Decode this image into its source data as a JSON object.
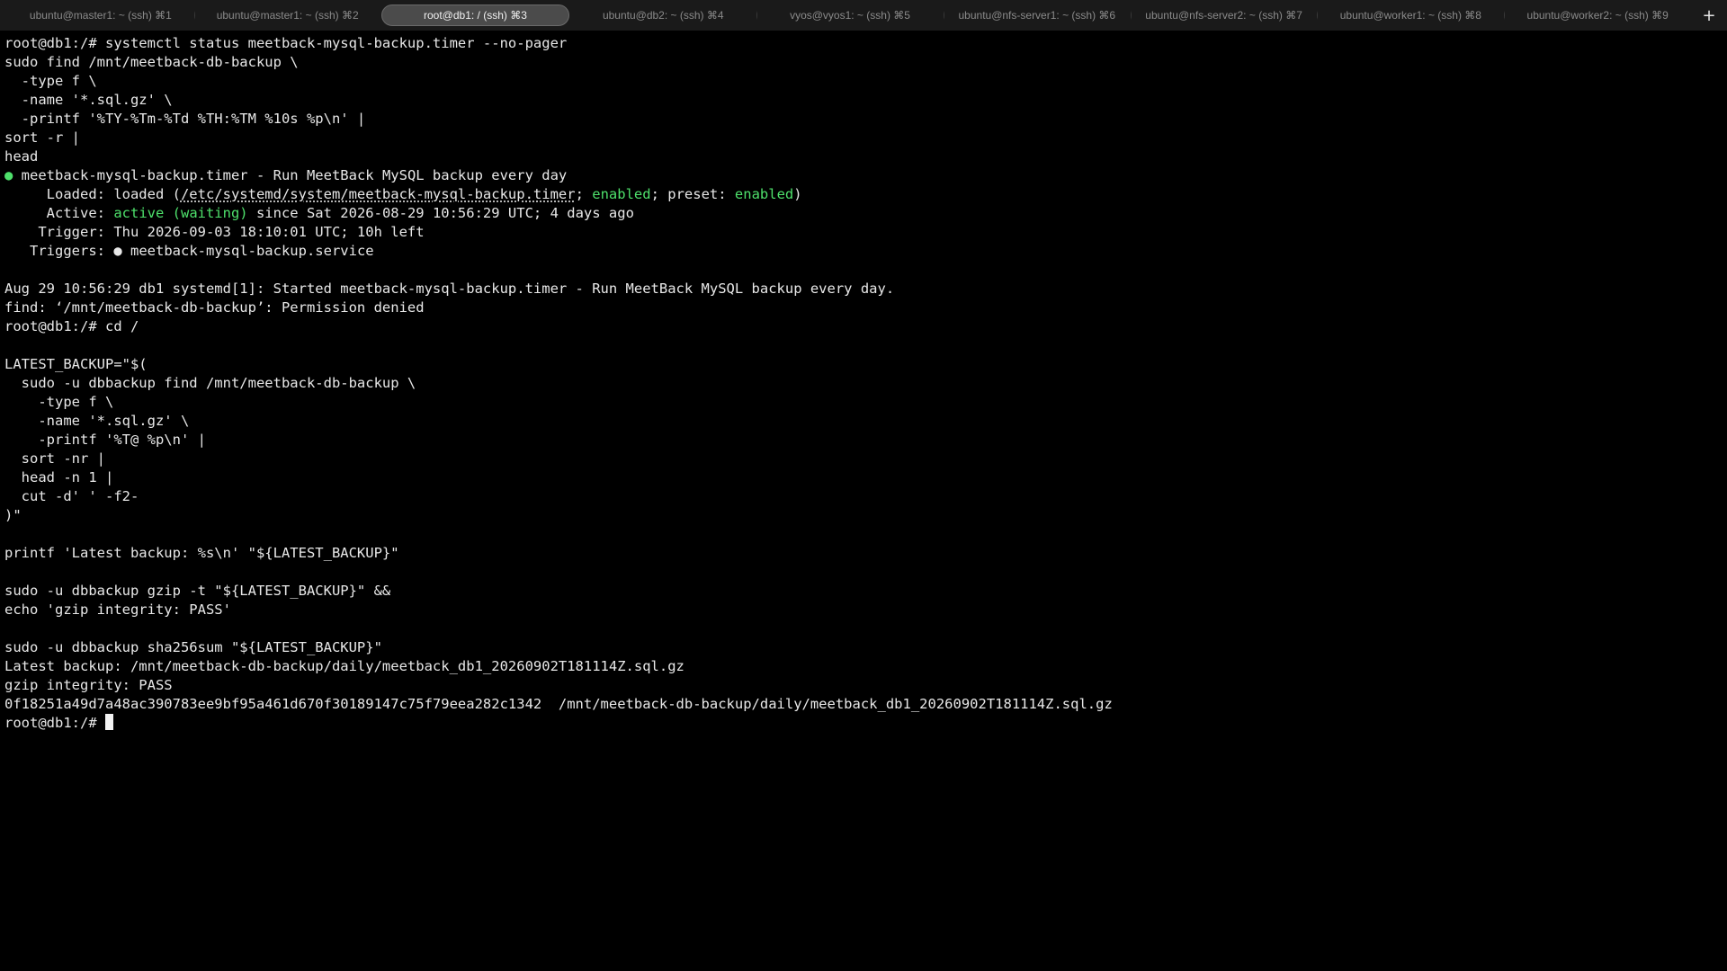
{
  "tabs": [
    {
      "label": "ubuntu@master1: ~ (ssh) ⌘1",
      "active": false
    },
    {
      "label": "ubuntu@master1: ~ (ssh) ⌘2",
      "active": false
    },
    {
      "label": "root@db1: / (ssh) ⌘3",
      "active": true
    },
    {
      "label": "ubuntu@db2: ~ (ssh) ⌘4",
      "active": false
    },
    {
      "label": "vyos@vyos1: ~ (ssh) ⌘5",
      "active": false
    },
    {
      "label": "ubuntu@nfs-server1: ~ (ssh) ⌘6",
      "active": false
    },
    {
      "label": "ubuntu@nfs-server2: ~ (ssh) ⌘7",
      "active": false
    },
    {
      "label": "ubuntu@worker1: ~ (ssh) ⌘8",
      "active": false
    },
    {
      "label": "ubuntu@worker2: ~ (ssh) ⌘9",
      "active": false
    }
  ],
  "new_tab_label": "+",
  "terminal": {
    "lines": [
      "root@db1:/# systemctl status meetback-mysql-backup.timer --no-pager",
      "sudo find /mnt/meetback-db-backup \\",
      "  -type f \\",
      "  -name '*.sql.gz' \\",
      "  -printf '%TY-%Tm-%Td %TH:%TM %10s %p\\n' |",
      "sort -r |",
      "head"
    ],
    "status": {
      "bullet": "●",
      "header": " meetback-mysql-backup.timer - Run MeetBack MySQL backup every day",
      "loaded_prefix": "     Loaded: loaded (",
      "loaded_path": "/etc/systemd/system/meetback-mysql-backup.timer",
      "loaded_sep1": "; ",
      "loaded_enabled": "enabled",
      "loaded_sep2": "; preset: ",
      "loaded_preset": "enabled",
      "loaded_suffix": ")",
      "active_prefix": "     Active: ",
      "active_state": "active (waiting)",
      "active_suffix": " since Sat 2026-08-29 10:56:29 UTC; 4 days ago",
      "trigger": "    Trigger: Thu 2026-09-03 18:10:01 UTC; 10h left",
      "triggers_prefix": "   Triggers: ",
      "triggers_bullet": "●",
      "triggers_suffix": " meetback-mysql-backup.service"
    },
    "lines_after": [
      "",
      "Aug 29 10:56:29 db1 systemd[1]: Started meetback-mysql-backup.timer - Run MeetBack MySQL backup every day.",
      "find: ‘/mnt/meetback-db-backup’: Permission denied",
      "root@db1:/# cd /",
      "",
      "LATEST_BACKUP=\"$(",
      "  sudo -u dbbackup find /mnt/meetback-db-backup \\",
      "    -type f \\",
      "    -name '*.sql.gz' \\",
      "    -printf '%T@ %p\\n' |",
      "  sort -nr |",
      "  head -n 1 |",
      "  cut -d' ' -f2-",
      ")\"",
      "",
      "printf 'Latest backup: %s\\n' \"${LATEST_BACKUP}\"",
      "",
      "sudo -u dbbackup gzip -t \"${LATEST_BACKUP}\" &&",
      "echo 'gzip integrity: PASS'",
      "",
      "sudo -u dbbackup sha256sum \"${LATEST_BACKUP}\"",
      "Latest backup: /mnt/meetback-db-backup/daily/meetback_db1_20260902T181114Z.sql.gz",
      "gzip integrity: PASS",
      "0f18251a49d7a48ac390783ee9bf95a461d670f30189147c75f79eea282c1342  /mnt/meetback-db-backup/daily/meetback_db1_20260902T181114Z.sql.gz"
    ],
    "prompt": "root@db1:/# "
  },
  "colors": {
    "background": "#000000",
    "foreground": "#e8e8e8",
    "accent_green": "#4ee06b",
    "tab_bar": "#1a1a1a",
    "active_tab": "#4b4b4b"
  }
}
